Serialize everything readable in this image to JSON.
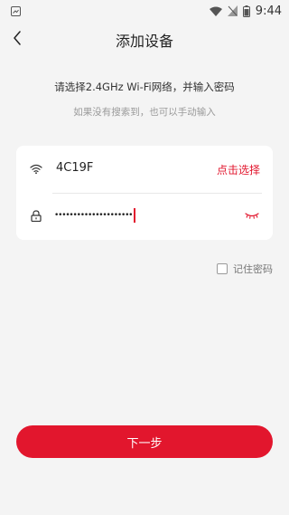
{
  "status_bar": {
    "time": "9:44",
    "icons": [
      "notification-icon",
      "wifi-signal-icon",
      "no-sim-icon",
      "battery-icon"
    ]
  },
  "header": {
    "back_icon": "chevron-left-icon",
    "title": "添加设备"
  },
  "instruction": "请选择2.4GHz Wi-Fi网络，并输入密码",
  "sub_instruction": "如果没有搜索到，也可以手动输入",
  "form": {
    "wifi": {
      "icon": "wifi-icon",
      "ssid": "4C19F",
      "select_label": "点击选择"
    },
    "password": {
      "icon": "lock-icon",
      "value": "•••••••••••••••••••••",
      "toggle_icon": "eye-closed-icon"
    }
  },
  "remember": {
    "label": "记住密码",
    "checked": false
  },
  "next_button": "下一步",
  "colors": {
    "accent": "#e2162d",
    "background": "#f4f4f4",
    "card": "#ffffff"
  }
}
